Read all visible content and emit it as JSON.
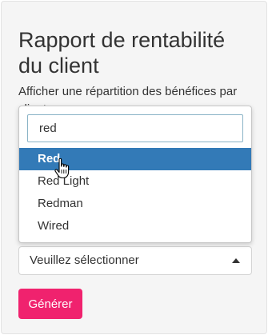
{
  "page": {
    "title": "Rapport de rentabilité du client",
    "description_line1": "Afficher une répartition des bénéfices par",
    "description_line2": "client."
  },
  "dropdown": {
    "search_value": "red",
    "options": [
      {
        "label": "Red",
        "selected": true
      },
      {
        "label": "Red Light",
        "selected": false
      },
      {
        "label": "Redman",
        "selected": false
      },
      {
        "label": "Wired",
        "selected": false
      }
    ]
  },
  "select": {
    "placeholder": "Veuillez sélectionner"
  },
  "generate_button": {
    "label": "Générer",
    "color": "#f0226e"
  },
  "colors": {
    "selected_option_bg": "#337ab7",
    "panel_bg": "#f5f5f5"
  },
  "icons": {
    "cursor": "hand-pointer-icon",
    "caret": "caret-up-icon"
  }
}
